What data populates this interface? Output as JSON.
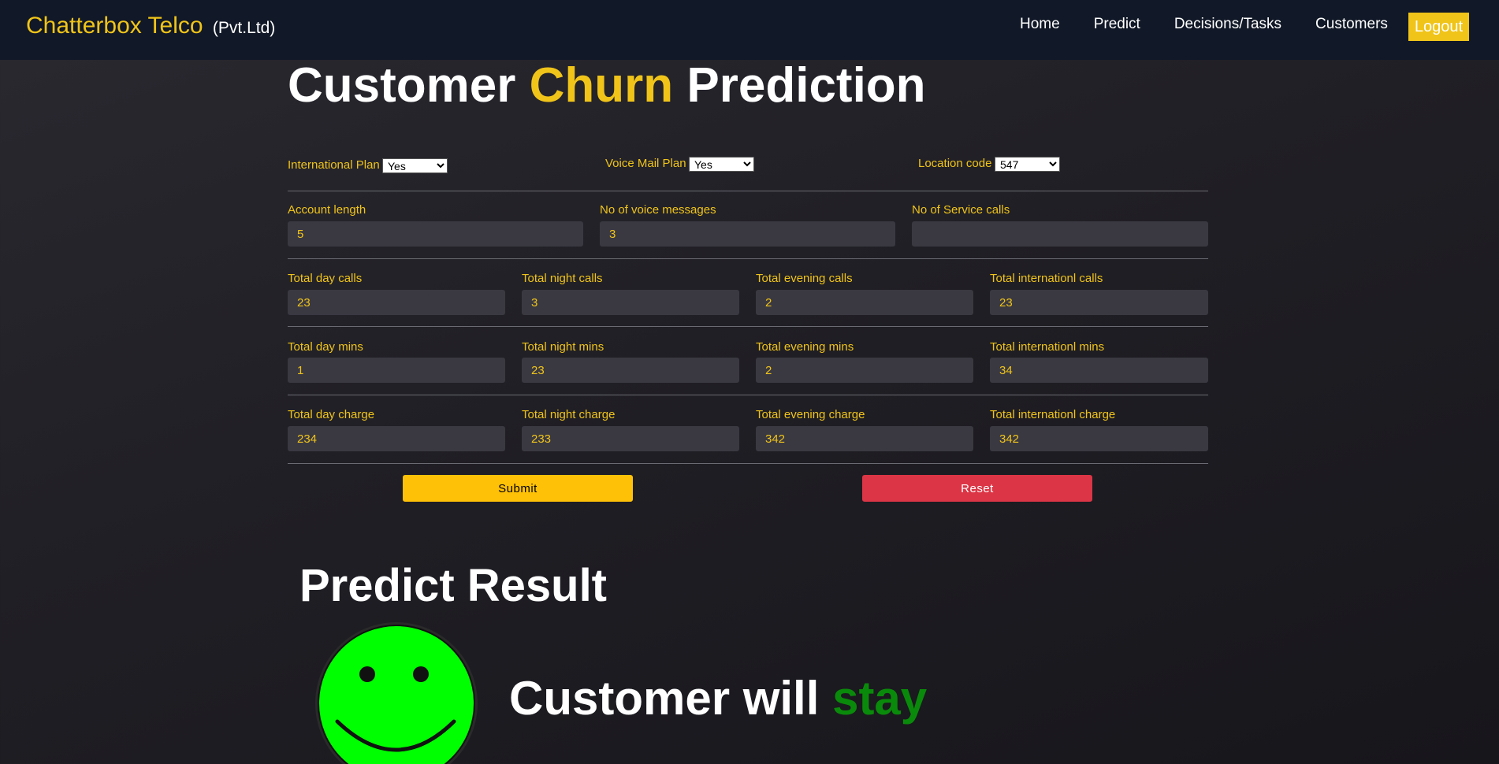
{
  "nav": {
    "brand": "Chatterbox Telco",
    "brand_suffix": "(Pvt.Ltd)",
    "links": [
      "Home",
      "Predict",
      "Decisions/Tasks",
      "Customers"
    ],
    "logout": "Logout"
  },
  "title": {
    "part1": "Customer",
    "accent": "Churn",
    "part2": "Prediction"
  },
  "selects": {
    "international_plan": {
      "label": "International Plan",
      "value": "Yes"
    },
    "voice_mail_plan": {
      "label": "Voice Mail Plan",
      "value": "Yes"
    },
    "location_code": {
      "label": "Location code",
      "value": "547"
    }
  },
  "row1": [
    {
      "label": "Account length",
      "value": "5"
    },
    {
      "label": "No of voice messages",
      "value": "3"
    },
    {
      "label": "No of Service calls",
      "value": ""
    }
  ],
  "calls": [
    {
      "label": "Total day calls",
      "value": "23"
    },
    {
      "label": "Total night calls",
      "value": "3"
    },
    {
      "label": "Total evening calls",
      "value": "2"
    },
    {
      "label": "Total internationl calls",
      "value": "23"
    }
  ],
  "mins": [
    {
      "label": "Total day mins",
      "value": "1"
    },
    {
      "label": "Total night mins",
      "value": "23"
    },
    {
      "label": "Total evening mins",
      "value": "2"
    },
    {
      "label": "Total internationl mins",
      "value": "34"
    }
  ],
  "charge": [
    {
      "label": "Total day charge",
      "value": "234"
    },
    {
      "label": "Total night charge",
      "value": "233"
    },
    {
      "label": "Total evening charge",
      "value": "342"
    },
    {
      "label": "Total internationl charge",
      "value": "342"
    }
  ],
  "buttons": {
    "submit": "Submit",
    "reset": "Reset"
  },
  "result": {
    "title": "Predict Result",
    "text_prefix": "Customer will",
    "text_accent": "stay",
    "icon": "smiley-face-icon"
  },
  "colors": {
    "accent": "#f0c419",
    "navbar": "#111827",
    "submit": "#ffc107",
    "reset": "#dc3545",
    "stay": "#0a8a0a",
    "smiley": "#00ff00"
  }
}
